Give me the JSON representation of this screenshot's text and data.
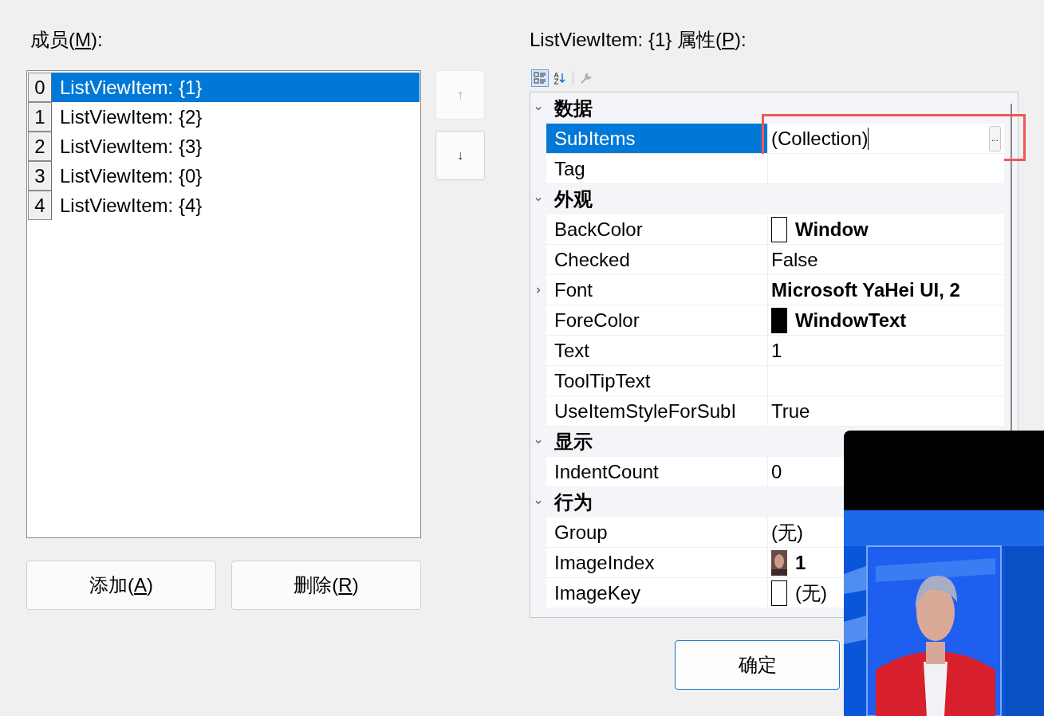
{
  "left_label": {
    "parts": [
      "成员(",
      "M",
      "):"
    ]
  },
  "members": [
    {
      "index": "0",
      "text": "ListViewItem: {1}",
      "selected": true
    },
    {
      "index": "1",
      "text": "ListViewItem: {2}",
      "selected": false
    },
    {
      "index": "2",
      "text": "ListViewItem: {3}",
      "selected": false
    },
    {
      "index": "3",
      "text": "ListViewItem: {0}",
      "selected": false
    },
    {
      "index": "4",
      "text": "ListViewItem: {4}",
      "selected": false
    }
  ],
  "move_buttons": [
    {
      "symbol": "↑",
      "disabled": true
    },
    {
      "symbol": "↓",
      "disabled": false
    }
  ],
  "member_buttons": [
    {
      "parts": [
        "添加(",
        "A",
        ")"
      ]
    },
    {
      "parts": [
        "删除(",
        "R",
        ")"
      ]
    }
  ],
  "right_label": {
    "parts": [
      "ListViewItem: {1} 属性(",
      "P",
      "):"
    ]
  },
  "toolbar": [
    {
      "kind": "categorized",
      "selected": true,
      "disabled": false
    },
    {
      "kind": "alphabetical",
      "selected": false,
      "disabled": false
    },
    {
      "kind": "property-pages",
      "selected": false,
      "disabled": true
    }
  ],
  "properties": [
    {
      "category": "数据",
      "expanded": true,
      "children": [
        {
          "name": "SubItems",
          "value": "(Collection)",
          "selected": true,
          "editing": true,
          "highlighted": true,
          "button_text": "...",
          "bold": false,
          "expandable": false
        },
        {
          "name": "Tag",
          "selected": false,
          "editing": false,
          "highlighted": false,
          "expandable": false
        }
      ]
    },
    {
      "category": "外观",
      "expanded": true,
      "children": [
        {
          "name": "BackColor",
          "value": "Window",
          "selected": false,
          "editing": false,
          "highlighted": false,
          "bold": true,
          "expandable": false,
          "swatch": {
            "kind": "color",
            "color": "#ffffff"
          }
        },
        {
          "name": "Checked",
          "value": "False",
          "selected": false,
          "editing": false,
          "highlighted": false,
          "bold": false,
          "expandable": false
        },
        {
          "name": "Font",
          "value": "Microsoft YaHei UI, 2",
          "selected": false,
          "editing": false,
          "highlighted": false,
          "bold": true,
          "expandable": true
        },
        {
          "name": "ForeColor",
          "value": "WindowText",
          "selected": false,
          "editing": false,
          "highlighted": false,
          "bold": true,
          "expandable": false,
          "swatch": {
            "kind": "color",
            "color": "#000000"
          }
        },
        {
          "name": "Text",
          "value": "1",
          "selected": false,
          "editing": false,
          "highlighted": false,
          "bold": false,
          "expandable": false
        },
        {
          "name": "ToolTipText",
          "selected": false,
          "editing": false,
          "highlighted": false,
          "expandable": false
        },
        {
          "name": "UseItemStyleForSubI",
          "value": "True",
          "selected": false,
          "editing": false,
          "highlighted": false,
          "bold": false,
          "expandable": false
        }
      ]
    },
    {
      "category": "显示",
      "expanded": true,
      "children": [
        {
          "name": "IndentCount",
          "value": "0",
          "selected": false,
          "editing": false,
          "highlighted": false,
          "bold": false,
          "expandable": false
        }
      ]
    },
    {
      "category": "行为",
      "expanded": true,
      "children": [
        {
          "name": "Group",
          "value": "(无)",
          "selected": false,
          "editing": false,
          "highlighted": false,
          "bold": false,
          "expandable": false
        },
        {
          "name": "ImageIndex",
          "value": "1",
          "selected": false,
          "editing": false,
          "highlighted": false,
          "bold": true,
          "expandable": false
        },
        {
          "name": "ImageKey",
          "value": "(无)",
          "selected": false,
          "editing": false,
          "highlighted": false,
          "bold": false,
          "expandable": false,
          "swatch": {
            "kind": "color",
            "color": "#ffffff"
          }
        }
      ]
    }
  ],
  "ok_button": "确定"
}
